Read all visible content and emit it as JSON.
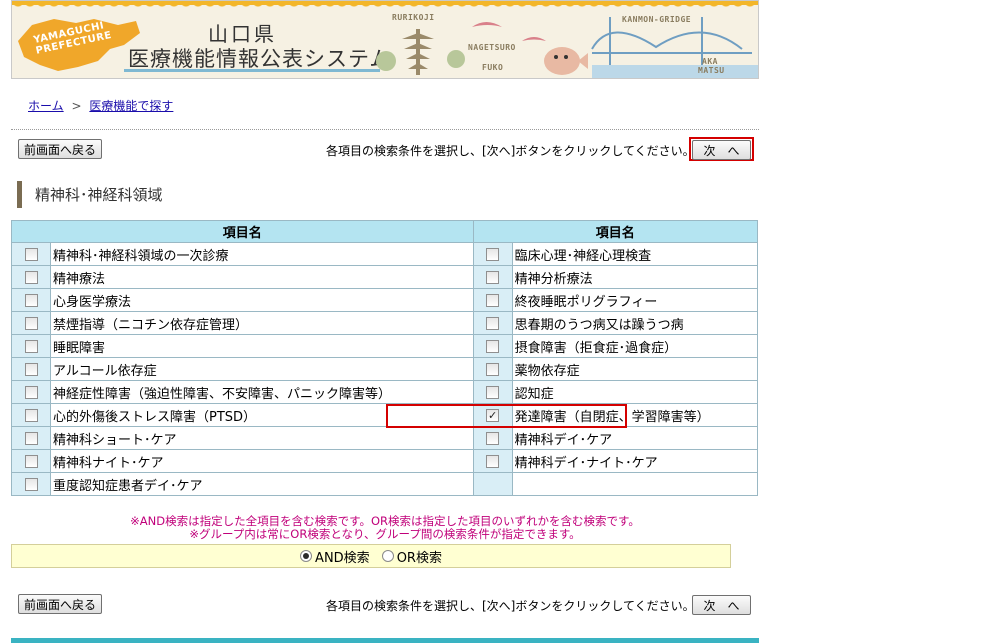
{
  "banner": {
    "prefecture_label_1": "YAMAGUCHI",
    "prefecture_label_2": "PREFECTURE",
    "title_top": "山口県",
    "title": "医療機能情報公表システム",
    "spots": [
      "RURIKOJI",
      "NAGETSURO",
      "FUKO",
      "KANMON-GRIDGE",
      "AKA",
      "MATSU"
    ]
  },
  "breadcrumb": {
    "home": "ホーム",
    "separator": ">",
    "current": "医療機能で探す"
  },
  "nav": {
    "back_label": "前画面へ戻る",
    "instruction": "各項目の検索条件を選択し、[次へ]ボタンをクリックしてください。→",
    "next_label": "次　へ"
  },
  "section": {
    "title": "精神科･神経科領域"
  },
  "table": {
    "header_left": "項目名",
    "header_right": "項目名",
    "rows": [
      {
        "left": "精神科･神経科領域の一次診療",
        "left_checked": false,
        "right": "臨床心理･神経心理検査",
        "right_checked": false
      },
      {
        "left": "精神療法",
        "left_checked": false,
        "right": "精神分析療法",
        "right_checked": false
      },
      {
        "left": "心身医学療法",
        "left_checked": false,
        "right": "終夜睡眠ポリグラフィー",
        "right_checked": false
      },
      {
        "left": "禁煙指導（ニコチン依存症管理）",
        "left_checked": false,
        "right": "思春期のうつ病又は躁うつ病",
        "right_checked": false
      },
      {
        "left": "睡眠障害",
        "left_checked": false,
        "right": "摂食障害（拒食症･過食症）",
        "right_checked": false
      },
      {
        "left": "アルコール依存症",
        "left_checked": false,
        "right": "薬物依存症",
        "right_checked": false
      },
      {
        "left": "神経症性障害（強迫性障害、不安障害、パニック障害等）",
        "left_checked": false,
        "right": "認知症",
        "right_checked": false
      },
      {
        "left": "心的外傷後ストレス障害（PTSD）",
        "left_checked": false,
        "right": "発達障害（自閉症、学習障害等）",
        "right_checked": true
      },
      {
        "left": "精神科ショート･ケア",
        "left_checked": false,
        "right": "精神科デイ･ケア",
        "right_checked": false
      },
      {
        "left": "精神科ナイト･ケア",
        "left_checked": false,
        "right": "精神科デイ･ナイト･ケア",
        "right_checked": false
      },
      {
        "left": "重度認知症患者デイ･ケア",
        "left_checked": false,
        "right": "",
        "right_checked": null
      }
    ]
  },
  "notes": {
    "line1": "※AND検索は指定した全項目を含む検索です。OR検索は指定した項目のいずれかを含む検索です。",
    "line2": "※グループ内は常にOR検索となり、グループ間の検索条件が指定できます。"
  },
  "search_mode": {
    "and_label": "AND検索",
    "or_label": "OR検索",
    "selected": "AND"
  },
  "colors": {
    "header_bg": "#b4e4f1",
    "checkbox_col_bg": "#d9eef6",
    "highlight": "#d40000",
    "note_text": "#c0007a",
    "andor_bg": "#ffffd2",
    "footer_line": "#3ab3c2"
  }
}
